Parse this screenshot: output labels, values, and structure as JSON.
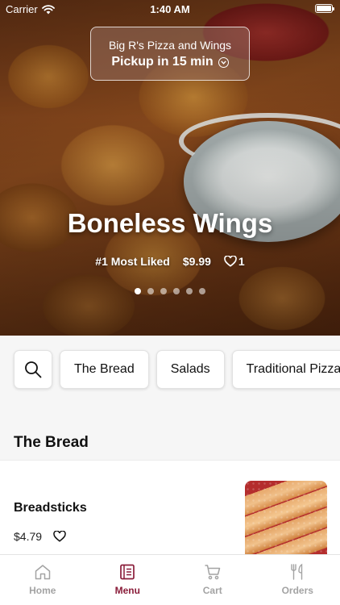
{
  "status_bar": {
    "carrier": "Carrier",
    "time": "1:40 AM"
  },
  "store": {
    "name": "Big R's Pizza and Wings",
    "pickup": "Pickup in 15 min"
  },
  "hero": {
    "title": "Boneless Wings",
    "badge": "#1 Most Liked",
    "price": "$9.99",
    "likes": "1",
    "slides_total": 6,
    "active_slide": 1
  },
  "categories": [
    {
      "label": "The Bread"
    },
    {
      "label": "Salads"
    },
    {
      "label": "Traditional Pizza"
    }
  ],
  "section": {
    "title": "The Bread"
  },
  "items": [
    {
      "name": "Breadsticks",
      "price": "$4.79"
    }
  ],
  "tabbar": {
    "tabs": [
      {
        "label": "Home",
        "icon": "home-icon"
      },
      {
        "label": "Menu",
        "icon": "menu-icon",
        "active": true
      },
      {
        "label": "Cart",
        "icon": "cart-icon"
      },
      {
        "label": "Orders",
        "icon": "orders-icon"
      }
    ]
  },
  "colors": {
    "accent": "#8a1d3a",
    "inactive": "#a3a3a3"
  }
}
